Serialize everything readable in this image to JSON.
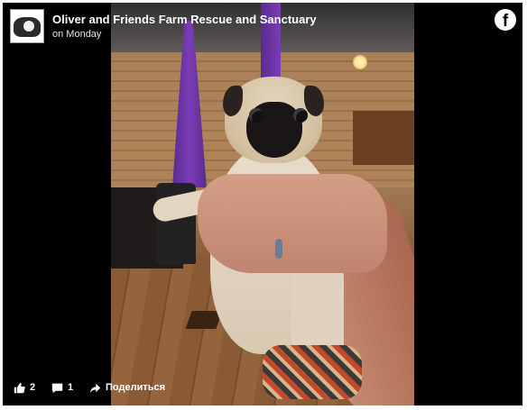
{
  "header": {
    "page_name": "Oliver and Friends Farm Rescue and Sanctuary",
    "post_time": "on Monday",
    "brand_logo_letter": "f"
  },
  "photo": {
    "description_icon": "photo"
  },
  "actions": {
    "like_count": "2",
    "comment_count": "1",
    "share_label": "Поделиться"
  },
  "icons": {
    "like": "thumbs-up-icon",
    "comment": "comment-icon",
    "share": "share-arrow-icon",
    "brand": "facebook-icon"
  },
  "colors": {
    "background": "#000000",
    "text": "#ffffff"
  }
}
